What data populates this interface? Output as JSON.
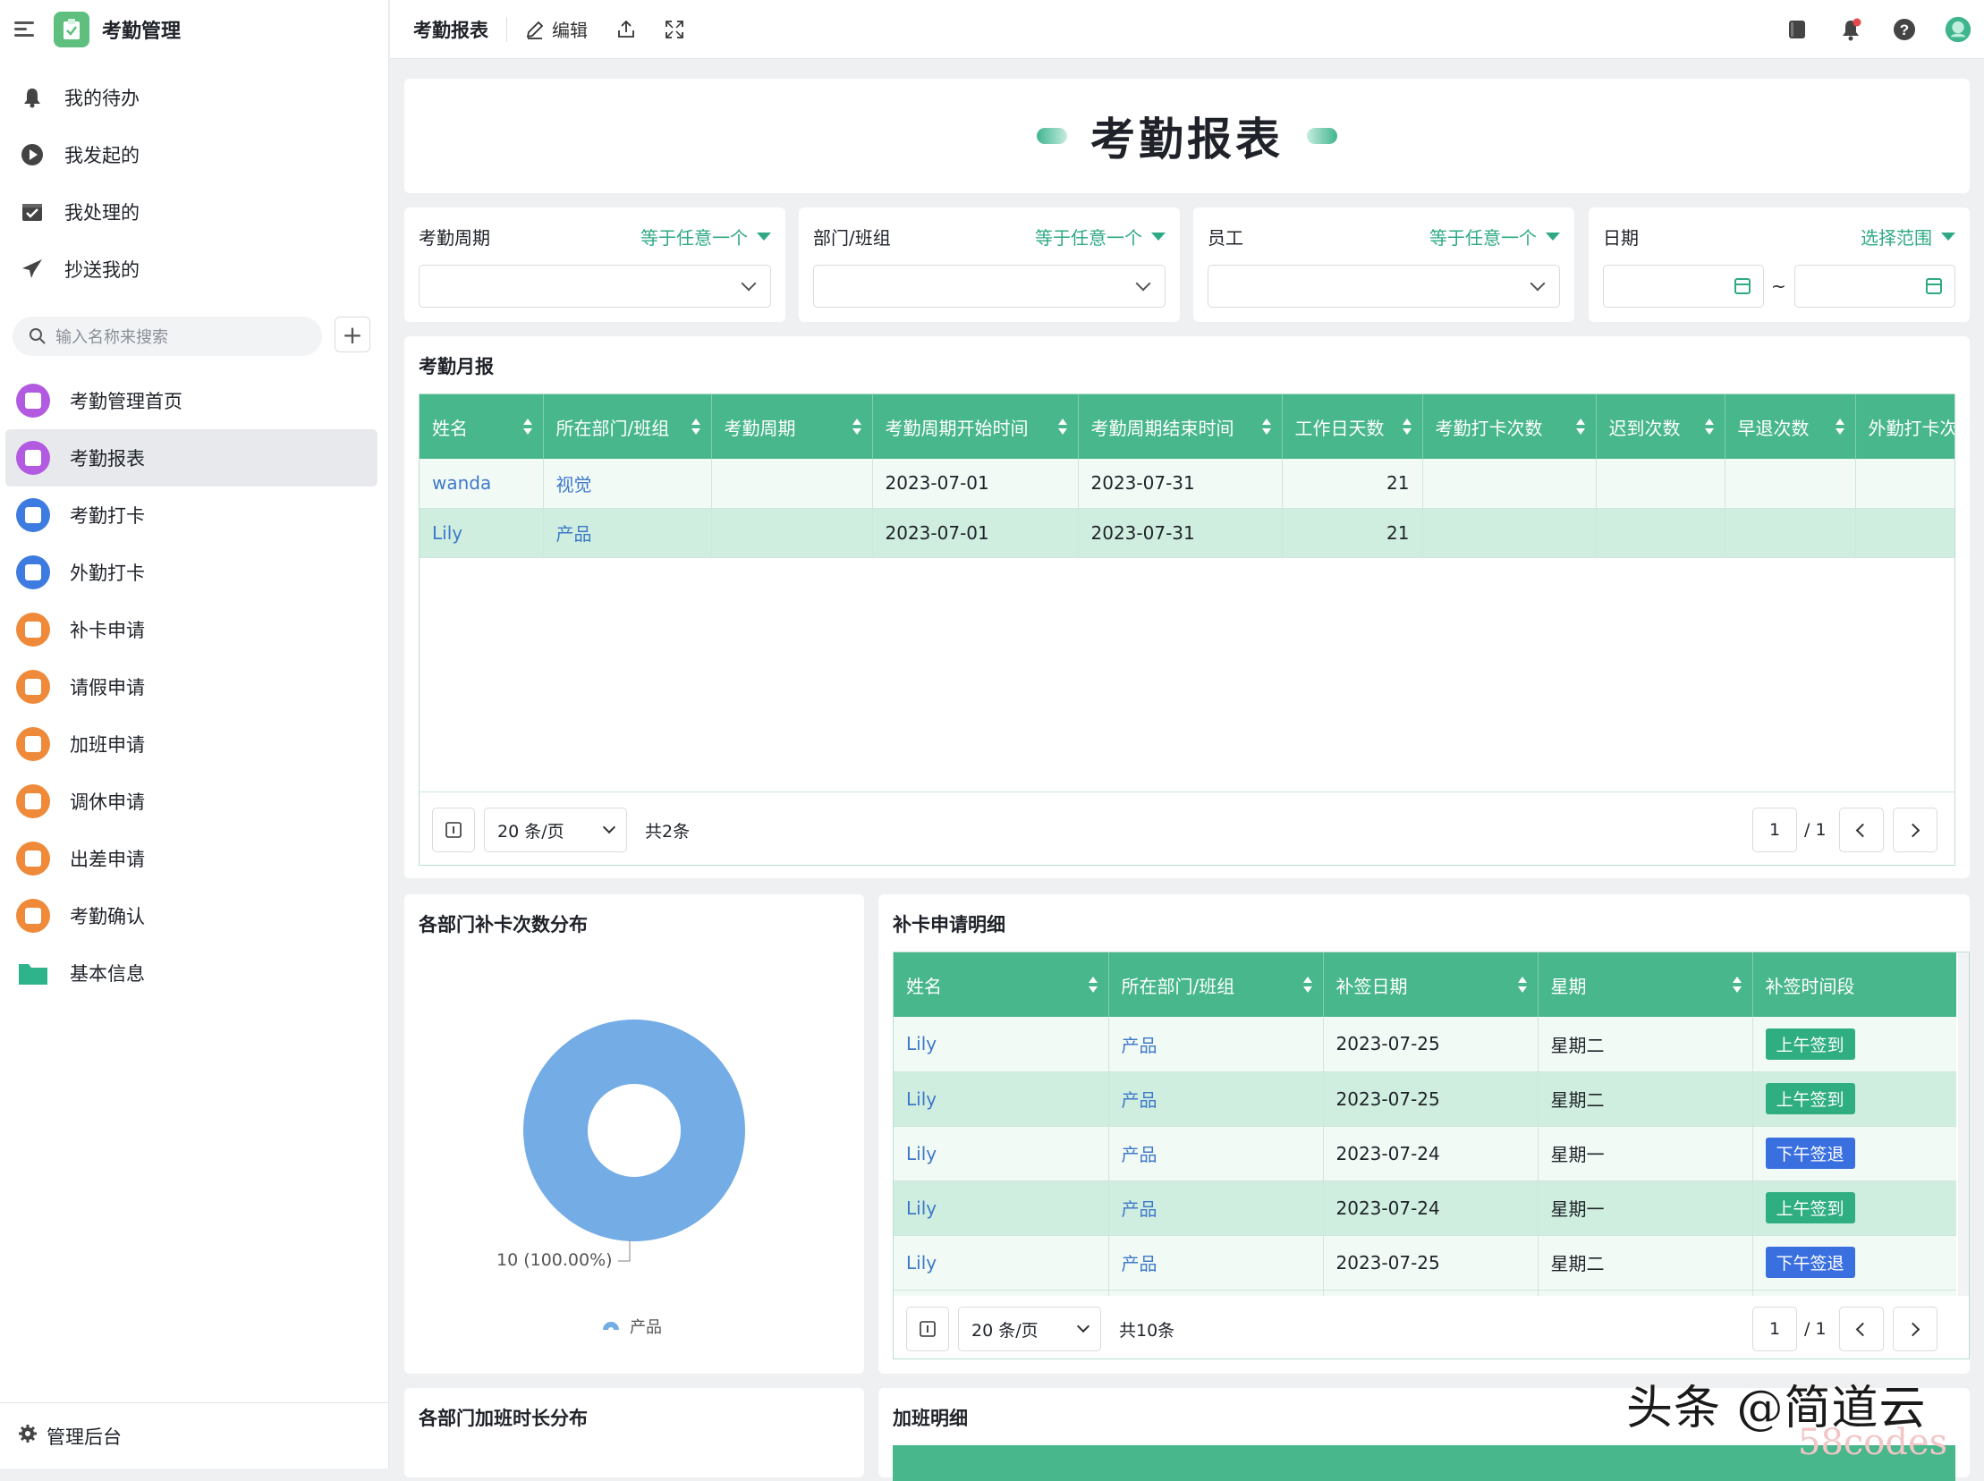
{
  "app": {
    "title": "考勤管理",
    "admin_label": "管理后台"
  },
  "sidebar": {
    "top_items": [
      {
        "label": "我的待办",
        "icon": "bell-icon"
      },
      {
        "label": "我发起的",
        "icon": "play-icon"
      },
      {
        "label": "我处理的",
        "icon": "check-box-icon"
      },
      {
        "label": "抄送我的",
        "icon": "send-icon"
      }
    ],
    "search_placeholder": "输入名称来搜索",
    "nav": [
      {
        "label": "考勤管理首页",
        "color": "#b25be0"
      },
      {
        "label": "考勤报表",
        "color": "#b25be0",
        "active": true
      },
      {
        "label": "考勤打卡",
        "color": "#3e7be0"
      },
      {
        "label": "外勤打卡",
        "color": "#3e7be0"
      },
      {
        "label": "补卡申请",
        "color": "#ef8a3a"
      },
      {
        "label": "请假申请",
        "color": "#ef8a3a"
      },
      {
        "label": "加班申请",
        "color": "#ef8a3a"
      },
      {
        "label": "调休申请",
        "color": "#ef8a3a"
      },
      {
        "label": "出差申请",
        "color": "#ef8a3a"
      },
      {
        "label": "考勤确认",
        "color": "#ef8a3a"
      },
      {
        "label": "基本信息",
        "color": "#2fb38a",
        "folder": true
      }
    ]
  },
  "topbar": {
    "title": "考勤报表",
    "edit_label": "编辑"
  },
  "report": {
    "title": "考勤报表"
  },
  "filters": [
    {
      "label": "考勤周期",
      "op": "等于任意一个"
    },
    {
      "label": "部门/班组",
      "op": "等于任意一个"
    },
    {
      "label": "员工",
      "op": "等于任意一个"
    },
    {
      "label": "日期",
      "op": "选择范围",
      "range_sep": "~"
    }
  ],
  "monthly": {
    "title": "考勤月报",
    "columns": [
      "姓名",
      "所在部门/班组",
      "考勤周期",
      "考勤周期开始时间",
      "考勤周期结束时间",
      "工作日天数",
      "考勤打卡次数",
      "迟到次数",
      "早退次数",
      "外勤打卡次"
    ],
    "rows": [
      [
        "wanda",
        "视觉",
        "",
        "2023-07-01",
        "2023-07-31",
        "21",
        "",
        "",
        "",
        ""
      ],
      [
        "Lily",
        "产品",
        "",
        "2023-07-01",
        "2023-07-31",
        "21",
        "",
        "",
        "",
        ""
      ]
    ],
    "page_size": "20 条/页",
    "total": "共2条",
    "page": "1",
    "pages": "/ 1"
  },
  "donut": {
    "title": "各部门补卡次数分布",
    "label": "10 (100.00%)",
    "legend": "产品",
    "color": "#74ace6"
  },
  "chart_data": {
    "type": "pie",
    "title": "各部门补卡次数分布",
    "categories": [
      "产品"
    ],
    "values": [
      10
    ],
    "labels": [
      "10 (100.00%)"
    ],
    "legend": "bottom"
  },
  "makeup": {
    "title": "补卡申请明细",
    "columns": [
      "姓名",
      "所在部门/班组",
      "补签日期",
      "星期",
      "补签时间段"
    ],
    "rows": [
      [
        "Lily",
        "产品",
        "2023-07-25",
        "星期二",
        "上午签到",
        "green"
      ],
      [
        "Lily",
        "产品",
        "2023-07-25",
        "星期二",
        "上午签到",
        "green"
      ],
      [
        "Lily",
        "产品",
        "2023-07-24",
        "星期一",
        "下午签退",
        "blue"
      ],
      [
        "Lily",
        "产品",
        "2023-07-24",
        "星期一",
        "上午签到",
        "green"
      ],
      [
        "Lily",
        "产品",
        "2023-07-25",
        "星期二",
        "下午签退",
        "blue"
      ]
    ],
    "page_size": "20 条/页",
    "total": "共10条",
    "page": "1",
    "pages": "/ 1"
  },
  "overtime_dist": {
    "title": "各部门加班时长分布"
  },
  "overtime": {
    "title": "加班明细"
  },
  "watermark": {
    "text": "头条 @简道云",
    "sub": "58codes"
  }
}
